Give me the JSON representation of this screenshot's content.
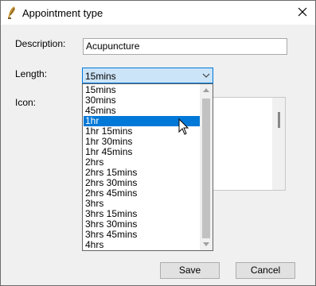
{
  "window": {
    "title": "Appointment type"
  },
  "form": {
    "description_label": "Description:",
    "description_value": "Acupuncture",
    "length_label": "Length:",
    "length_value": "15mins",
    "icon_label": "Icon:"
  },
  "length_options": [
    "15mins",
    "30mins",
    "45mins",
    "1hr",
    "1hr 15mins",
    "1hr 30mins",
    "1hr 45mins",
    "2hrs",
    "2hrs 15mins",
    "2hrs 30mins",
    "2hrs 45mins",
    "3hrs",
    "3hrs 15mins",
    "3hrs 30mins",
    "3hrs 45mins",
    "4hrs"
  ],
  "highlighted_option": "1hr",
  "buttons": {
    "save": "Save",
    "cancel": "Cancel"
  },
  "icons": {
    "app": "app-feather-icon",
    "close": "close-icon",
    "dropdown": "chevron-down-icon"
  },
  "colors": {
    "selection": "#0078d7",
    "combo_bg": "#cce4f7"
  }
}
